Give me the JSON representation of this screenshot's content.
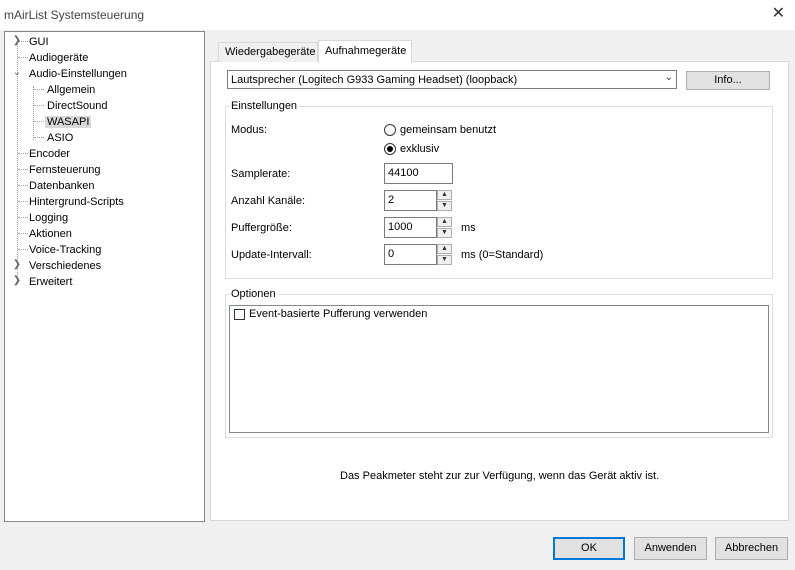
{
  "window": {
    "title": "mAirList Systemsteuerung"
  },
  "tree": {
    "items": [
      {
        "label": "GUI",
        "expander": "collapsed"
      },
      {
        "label": "Audiogeräte"
      },
      {
        "label": "Audio-Einstellungen",
        "expander": "expanded"
      },
      {
        "label": "Allgemein"
      },
      {
        "label": "DirectSound"
      },
      {
        "label": "WASAPI",
        "selected": true
      },
      {
        "label": "ASIO"
      },
      {
        "label": "Encoder"
      },
      {
        "label": "Fernsteuerung"
      },
      {
        "label": "Datenbanken"
      },
      {
        "label": "Hintergrund-Scripts"
      },
      {
        "label": "Logging"
      },
      {
        "label": "Aktionen"
      },
      {
        "label": "Voice-Tracking"
      },
      {
        "label": "Verschiedenes",
        "expander": "collapsed"
      },
      {
        "label": "Erweitert",
        "expander": "collapsed"
      }
    ]
  },
  "tabs": [
    {
      "label": "Wiedergabegeräte",
      "active": false
    },
    {
      "label": "Aufnahmegeräte",
      "active": true
    }
  ],
  "device": {
    "selected": "Lautsprecher (Logitech G933 Gaming Headset) (loopback)",
    "info_button": "Info..."
  },
  "settings": {
    "legend": "Einstellungen",
    "mode_label": "Modus:",
    "mode_options": [
      {
        "label": "gemeinsam benutzt",
        "checked": false
      },
      {
        "label": "exklusiv",
        "checked": true
      }
    ],
    "samplerate_label": "Samplerate:",
    "samplerate_value": "44100",
    "channels_label": "Anzahl Kanäle:",
    "channels_value": "2",
    "buffer_label": "Puffergröße:",
    "buffer_value": "1000",
    "buffer_unit": "ms",
    "update_label": "Update-Intervall:",
    "update_value": "0",
    "update_unit": "ms (0=Standard)"
  },
  "options": {
    "legend": "Optionen",
    "items": [
      {
        "label": "Event-basierte Pufferung verwenden",
        "checked": false
      }
    ]
  },
  "peakmeter_note": "Das Peakmeter steht zur zur Verfügung, wenn das Gerät aktiv ist.",
  "buttons": {
    "ok": "OK",
    "apply": "Anwenden",
    "cancel": "Abbrechen"
  }
}
